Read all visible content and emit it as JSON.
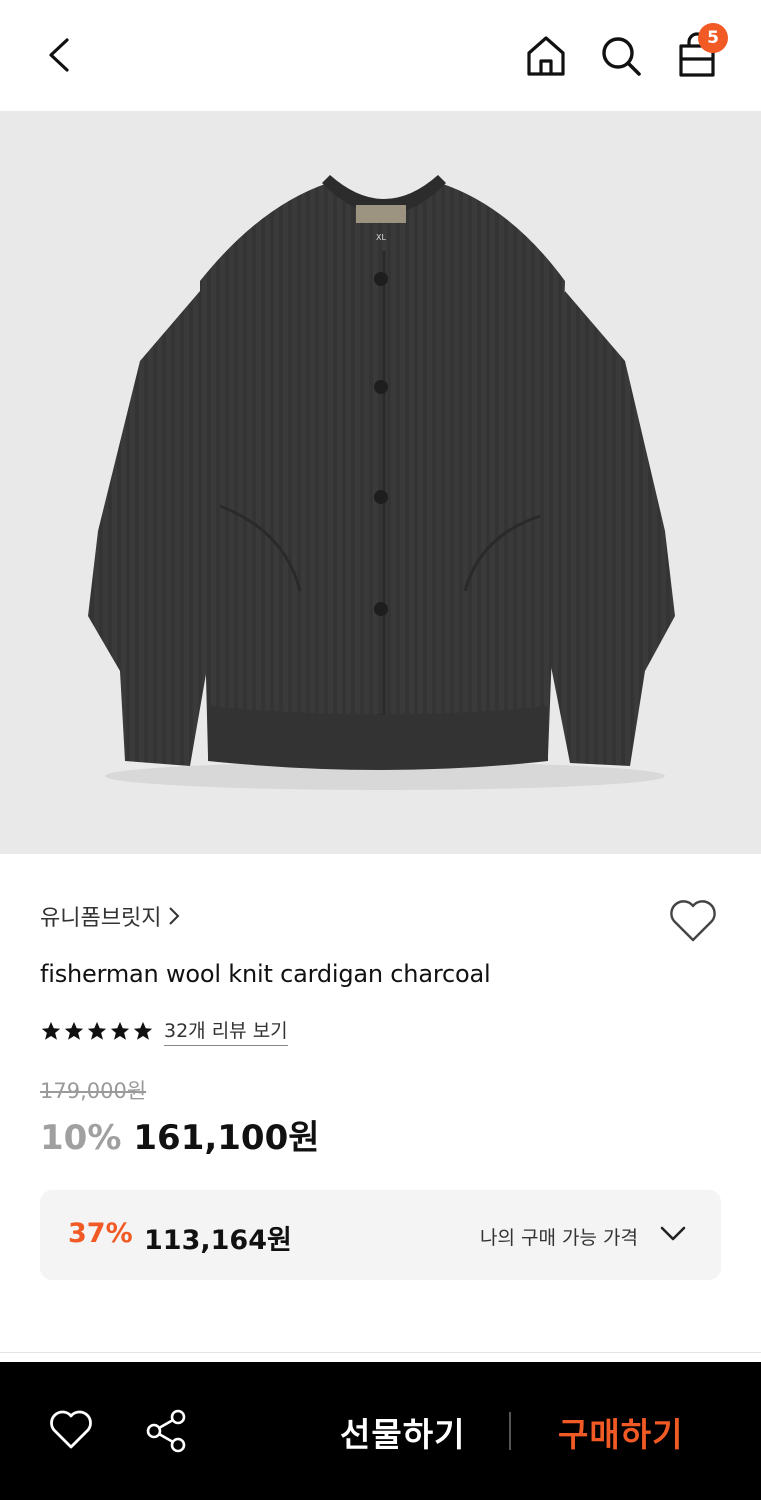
{
  "header": {
    "back_icon": "chevron-left-icon",
    "home_icon": "home-icon",
    "search_icon": "search-icon",
    "cart_icon": "shopping-bag-icon",
    "cart_count": "5"
  },
  "product": {
    "image_alt_icon": "cardigan-image",
    "brand": "유니폼브릿지",
    "name": "fisherman wool knit cardigan charcoal",
    "rating_stars": 5,
    "review_link": "32개 리뷰 보기",
    "original_price": "179,000원",
    "discount_rate": "10%",
    "sale_price": "161,100원"
  },
  "my_price": {
    "discount_rate": "37%",
    "price": "113,164원",
    "label": "나의 구매 가능 가격"
  },
  "bottom_bar": {
    "wish_icon": "heart-icon",
    "share_icon": "share-icon",
    "gift_label": "선물하기",
    "buy_label": "구매하기"
  },
  "colors": {
    "accent": "#f15a24",
    "bottom_bar_bg": "#000000",
    "image_bg": "#e9e9e9"
  }
}
